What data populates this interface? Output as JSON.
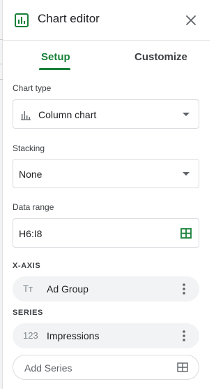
{
  "header": {
    "title": "Chart editor"
  },
  "tabs": {
    "setup": "Setup",
    "customize": "Customize"
  },
  "chart_type": {
    "label": "Chart type",
    "value": "Column chart"
  },
  "stacking": {
    "label": "Stacking",
    "value": "None"
  },
  "data_range": {
    "label": "Data range",
    "value": "H6:I8"
  },
  "x_axis": {
    "label": "X-AXIS",
    "icon_text": "Tт",
    "value": "Ad Group"
  },
  "series": {
    "label": "SERIES",
    "icon_text": "123",
    "value": "Impressions"
  },
  "add_series": {
    "label": "Add Series"
  },
  "icons": {
    "chart": "bar-chart-icon",
    "close": "close-icon",
    "column_chart": "column-chart-icon",
    "grid": "grid-icon",
    "more": "more-vert-icon"
  },
  "colors": {
    "accent": "#188038",
    "chip": "#f1f3f4",
    "border": "#dadce0"
  }
}
